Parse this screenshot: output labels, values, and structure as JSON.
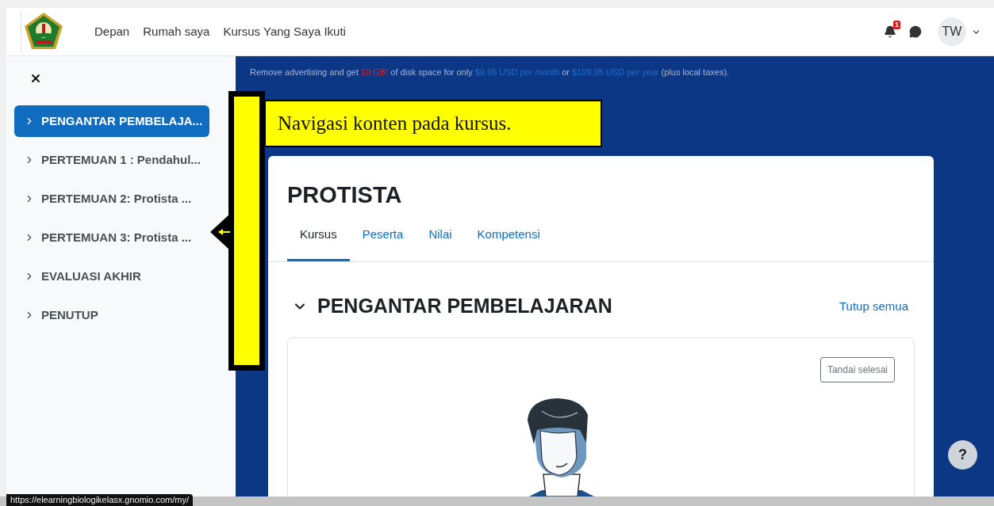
{
  "header": {
    "nav_links": [
      "Depan",
      "Rumah saya",
      "Kursus Yang Saya Ikuti"
    ],
    "notification_count": "1",
    "avatar_initials": "TW"
  },
  "sidebar": {
    "items": [
      {
        "label": "PENGANTAR PEMBELAJA...",
        "selected": true
      },
      {
        "label": "PERTEMUAN 1 : Pendahul...",
        "selected": false
      },
      {
        "label": "PERTEMUAN 2: Protista ...",
        "selected": false
      },
      {
        "label": "PERTEMUAN 3: Protista ...",
        "selected": false
      },
      {
        "label": "EVALUASI AKHIR",
        "selected": false
      },
      {
        "label": "PENUTUP",
        "selected": false
      }
    ]
  },
  "ad_banner": {
    "segments": [
      {
        "kind": "text",
        "text": "Remove advertising and get "
      },
      {
        "kind": "highlight",
        "text": "10 GB!"
      },
      {
        "kind": "text",
        "text": " of disk space for only "
      },
      {
        "kind": "link",
        "text": "$9.95 USD per month"
      },
      {
        "kind": "text",
        "text": " or "
      },
      {
        "kind": "link",
        "text": "$109.95 USD per year"
      },
      {
        "kind": "text",
        "text": " (plus local taxes)."
      }
    ]
  },
  "annotation": {
    "text": "Navigasi konten pada kursus."
  },
  "course": {
    "title": "PROTISTA",
    "tabs": [
      {
        "label": "Kursus",
        "selected": true
      },
      {
        "label": "Peserta",
        "selected": false
      },
      {
        "label": "Nilai",
        "selected": false
      },
      {
        "label": "Kompetensi",
        "selected": false
      }
    ],
    "section": {
      "title": "PENGANTAR PEMBELAJARAN",
      "expanded": true,
      "collapse_link": "Tutup semua",
      "complete_button": "Tandai selesai"
    }
  },
  "help_button": "?",
  "status_url": "https://elearningbiologikelasx.gnomio.com/my/"
}
